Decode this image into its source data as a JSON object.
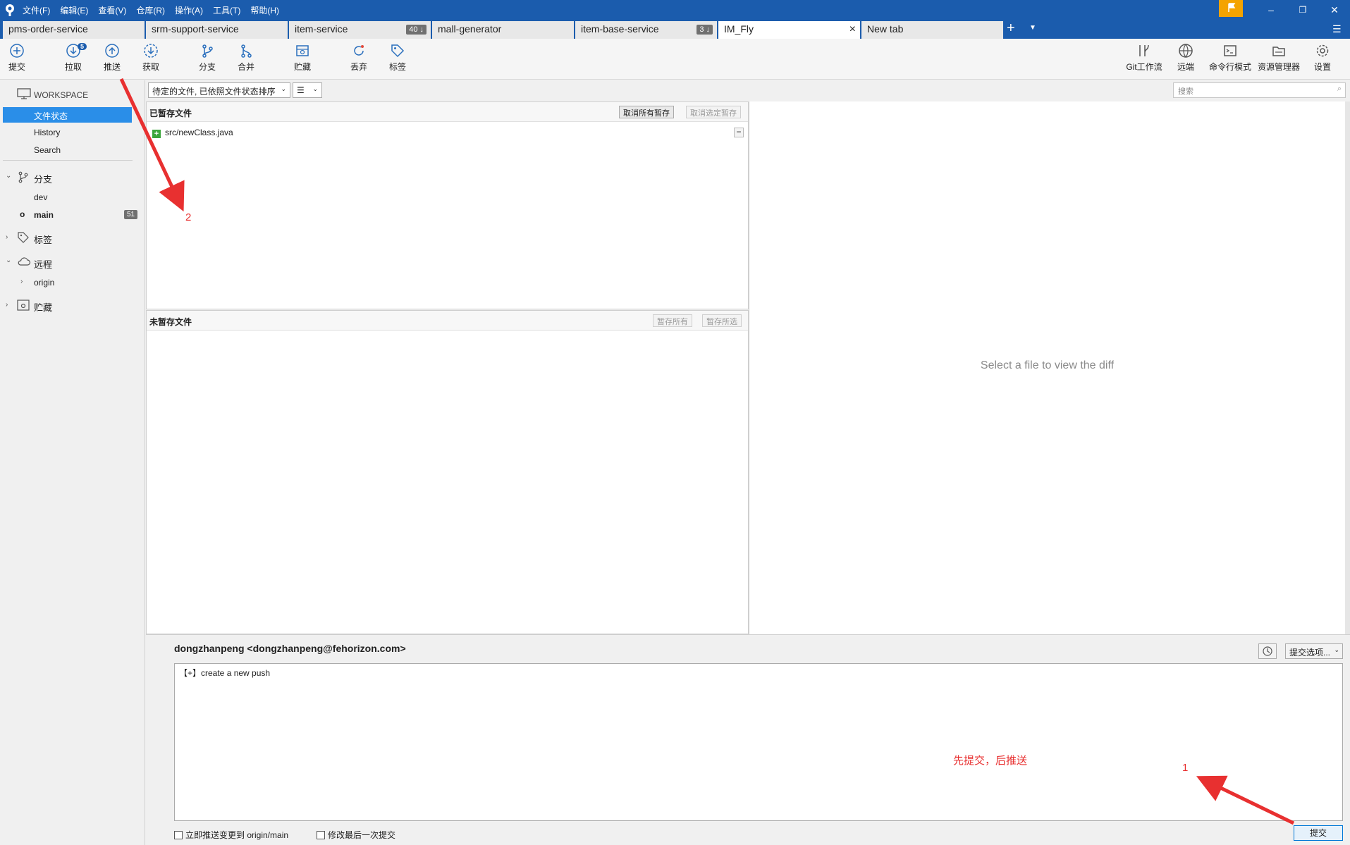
{
  "menu": [
    "文件(F)",
    "编辑(E)",
    "查看(V)",
    "仓库(R)",
    "操作(A)",
    "工具(T)",
    "帮助(H)"
  ],
  "tabs": [
    {
      "label": "pms-order-service",
      "badge": ""
    },
    {
      "label": "srm-support-service",
      "badge": ""
    },
    {
      "label": "item-service",
      "badge": "40 ↓"
    },
    {
      "label": "mall-generator",
      "badge": ""
    },
    {
      "label": "item-base-service",
      "badge": "3 ↓"
    },
    {
      "label": "IM_Fly",
      "badge": ""
    },
    {
      "label": "New tab",
      "badge": ""
    }
  ],
  "toolbar": {
    "commit": "提交",
    "pull": "拉取",
    "pull_count": "5",
    "push": "推送",
    "fetch": "获取",
    "branch": "分支",
    "merge": "合并",
    "stash": "贮藏",
    "discard": "丢弃",
    "tag": "标签",
    "gitflow": "Git工作流",
    "remote": "远端",
    "terminal": "命令行模式",
    "explorer": "资源管理器",
    "settings": "设置"
  },
  "sidebar": {
    "workspace": "WORKSPACE",
    "file_status": "文件状态",
    "history": "History",
    "search": "Search",
    "branches": "分支",
    "branch_dev": "dev",
    "branch_main": "main",
    "main_badge": "51",
    "tags": "标签",
    "remotes": "远程",
    "origin": "origin",
    "stashes": "贮藏"
  },
  "filter": {
    "sort": "待定的文件, 已依照文件状态排序",
    "view": "☰"
  },
  "search": {
    "placeholder": "搜索"
  },
  "staged": {
    "title": "已暂存文件",
    "unstage_all": "取消所有暂存",
    "unstage_selected": "取消选定暂存",
    "files": [
      "src/newClass.java"
    ]
  },
  "unstaged": {
    "title": "未暂存文件",
    "stage_all": "暂存所有",
    "stage_selected": "暂存所选"
  },
  "diff": {
    "message": "Select a file to view the diff"
  },
  "commit": {
    "author": "dongzhanpeng <dongzhanpeng@fehorizon.com>",
    "message": "【+】create a new push",
    "options": "提交选项...",
    "push_immediately": "立即推送变更到 origin/main",
    "amend": "修改最后一次提交",
    "button": "提交"
  },
  "annotations": {
    "note": "先提交，后推送",
    "step1": "1",
    "step2": "2"
  }
}
